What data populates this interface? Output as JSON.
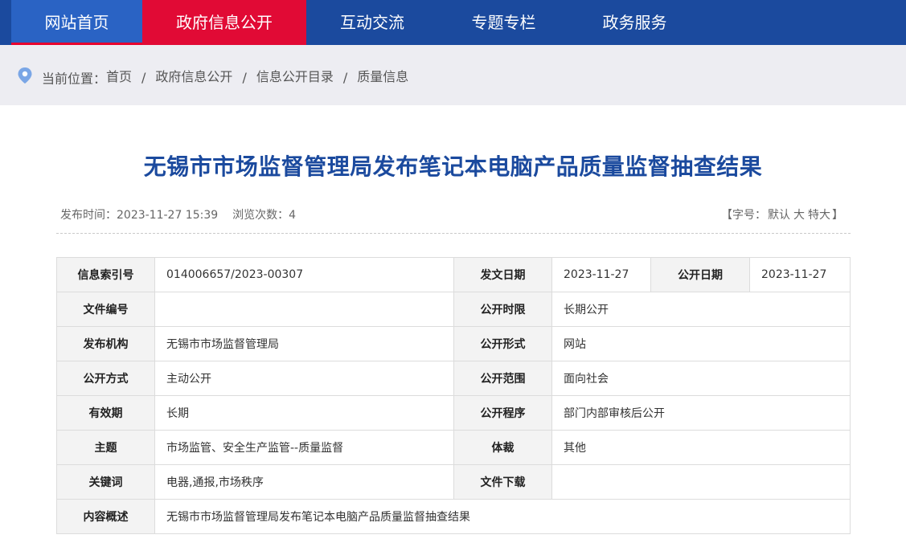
{
  "nav": {
    "items": [
      "网站首页",
      "政府信息公开",
      "互动交流",
      "专题专栏",
      "政务服务"
    ]
  },
  "breadcrumb": {
    "prefix": "当前位置：",
    "items": [
      "首页",
      "政府信息公开",
      "信息公开目录",
      "质量信息"
    ],
    "separator": "/"
  },
  "article": {
    "title": "无锡市市场监督管理局发布笔记本电脑产品质量监督抽查结果",
    "publish_label": "发布时间：",
    "publish_time": "2023-11-27 15:39",
    "views_label": "浏览次数：",
    "views": "4",
    "fontsize_open": "【字号：",
    "fontsize_default": "默认",
    "fontsize_large": "大",
    "fontsize_xlarge": "特大",
    "fontsize_close": "】"
  },
  "info_table": {
    "index_no_label": "信息索引号",
    "index_no": "014006657/2023-00307",
    "issue_date_label": "发文日期",
    "issue_date": "2023-11-27",
    "open_date_label": "公开日期",
    "open_date": "2023-11-27",
    "doc_no_label": "文件编号",
    "doc_no": "",
    "open_period_label": "公开时限",
    "open_period": "长期公开",
    "publisher_label": "发布机构",
    "publisher": "无锡市市场监督管理局",
    "open_form_label": "公开形式",
    "open_form": "网站",
    "open_method_label": "公开方式",
    "open_method": "主动公开",
    "open_scope_label": "公开范围",
    "open_scope": "面向社会",
    "validity_label": "有效期",
    "validity": "长期",
    "open_procedure_label": "公开程序",
    "open_procedure": "部门内部审核后公开",
    "topic_label": "主题",
    "topic": "市场监管、安全生产监管--质量监督",
    "genre_label": "体裁",
    "genre": "其他",
    "keywords_label": "关键词",
    "keywords": "电器,通报,市场秩序",
    "download_label": "文件下载",
    "download": "",
    "summary_label": "内容概述",
    "summary": "无锡市市场监督管理局发布笔记本电脑产品质量监督抽查结果"
  }
}
